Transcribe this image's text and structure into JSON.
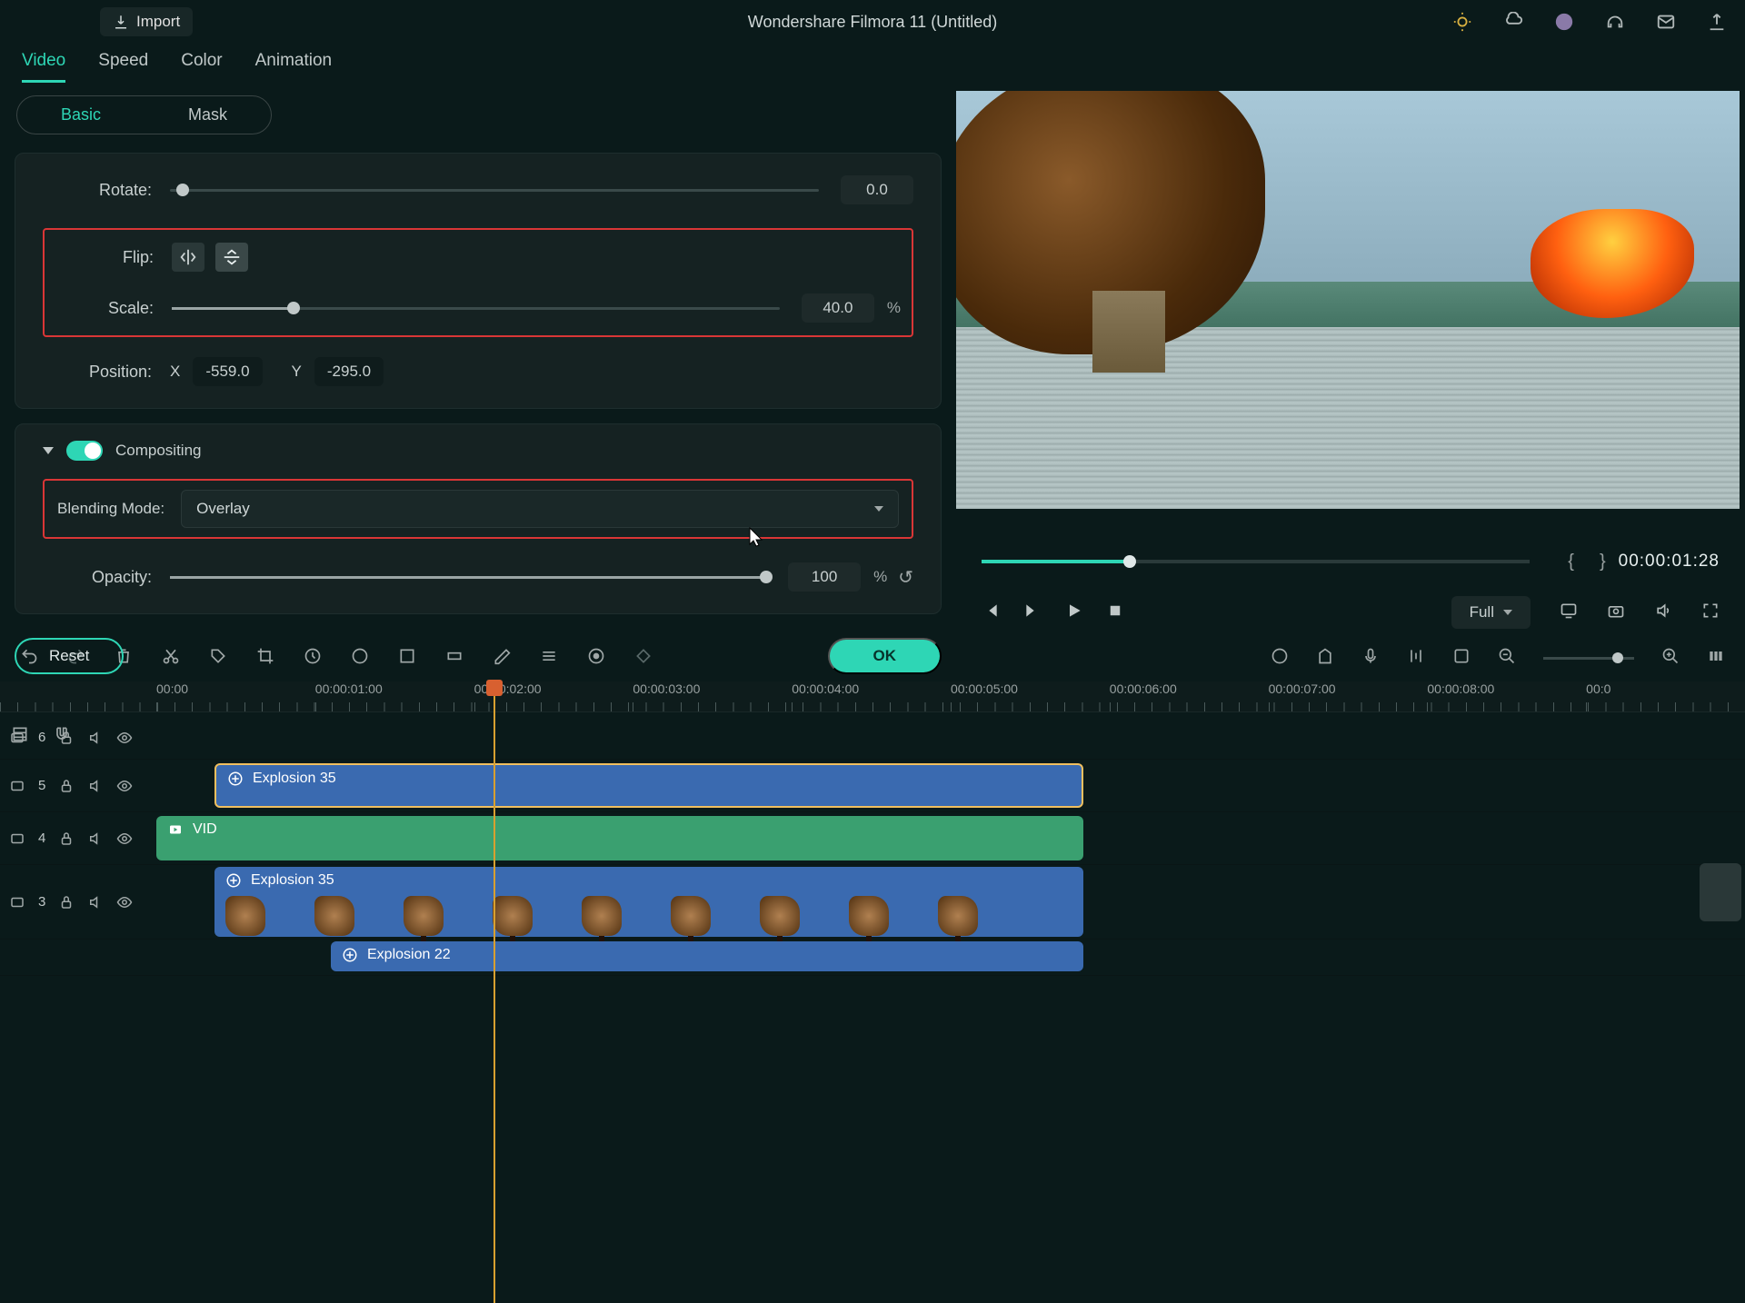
{
  "header": {
    "import_label": "Import",
    "title": "Wondershare Filmora 11 (Untitled)"
  },
  "tabs": [
    "Video",
    "Speed",
    "Color",
    "Animation"
  ],
  "active_tab": 0,
  "subtabs": [
    "Basic",
    "Mask"
  ],
  "active_subtab": 0,
  "transform": {
    "rotate_label": "Rotate:",
    "rotate_value": "0.0",
    "rotate_pct": 0,
    "flip_label": "Flip:",
    "scale_label": "Scale:",
    "scale_value": "40.0",
    "scale_unit": "%",
    "scale_pct": 20,
    "position_label": "Position:",
    "x_label": "X",
    "x_value": "-559.0",
    "y_label": "Y",
    "y_value": "-295.0"
  },
  "compositing": {
    "section_label": "Compositing",
    "blend_label": "Blending Mode:",
    "blend_value": "Overlay",
    "opacity_label": "Opacity:",
    "opacity_value": "100",
    "opacity_unit": "%",
    "opacity_pct": 100
  },
  "buttons": {
    "reset": "Reset",
    "ok": "OK"
  },
  "preview": {
    "timecode": "00:00:01:28",
    "full_label": "Full"
  },
  "timeline": {
    "ruler": [
      "00:00",
      "00:00:01:00",
      "00:00:02:00",
      "00:00:03:00",
      "00:00:04:00",
      "00:00:05:00",
      "00:00:06:00",
      "00:00:07:00",
      "00:00:08:00",
      "00:0"
    ],
    "tracks": [
      {
        "num": "6"
      },
      {
        "num": "5"
      },
      {
        "num": "4"
      },
      {
        "num": "3"
      }
    ],
    "clips": {
      "c1": "Explosion 35",
      "c2": "VID",
      "c3": "Explosion 35",
      "c4": "Explosion 22"
    }
  }
}
